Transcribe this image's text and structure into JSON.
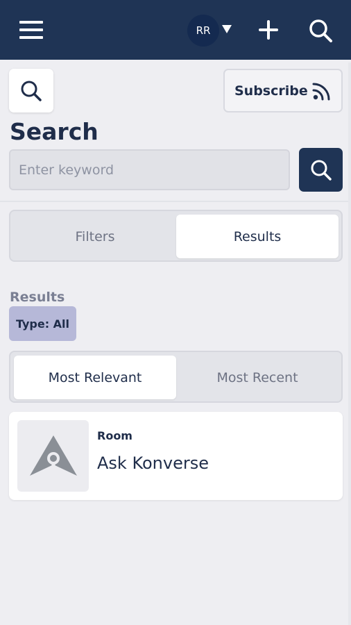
{
  "header": {
    "avatar_initials": "RR",
    "bg_color": "#1f3455"
  },
  "toolbar": {
    "subscribe_label": "Subscribe"
  },
  "search": {
    "title": "Search",
    "placeholder": "Enter keyword"
  },
  "view_tabs": [
    {
      "label": "Filters",
      "selected": false
    },
    {
      "label": "Results",
      "selected": true
    }
  ],
  "results": {
    "heading": "Results",
    "type_chip": "Type: All",
    "sort_tabs": [
      {
        "label": "Most Relevant",
        "selected": true
      },
      {
        "label": "Most Recent",
        "selected": false
      }
    ],
    "items": [
      {
        "type": "Room",
        "name": "Ask Konverse",
        "icon": "konverse-logo-icon"
      }
    ]
  }
}
